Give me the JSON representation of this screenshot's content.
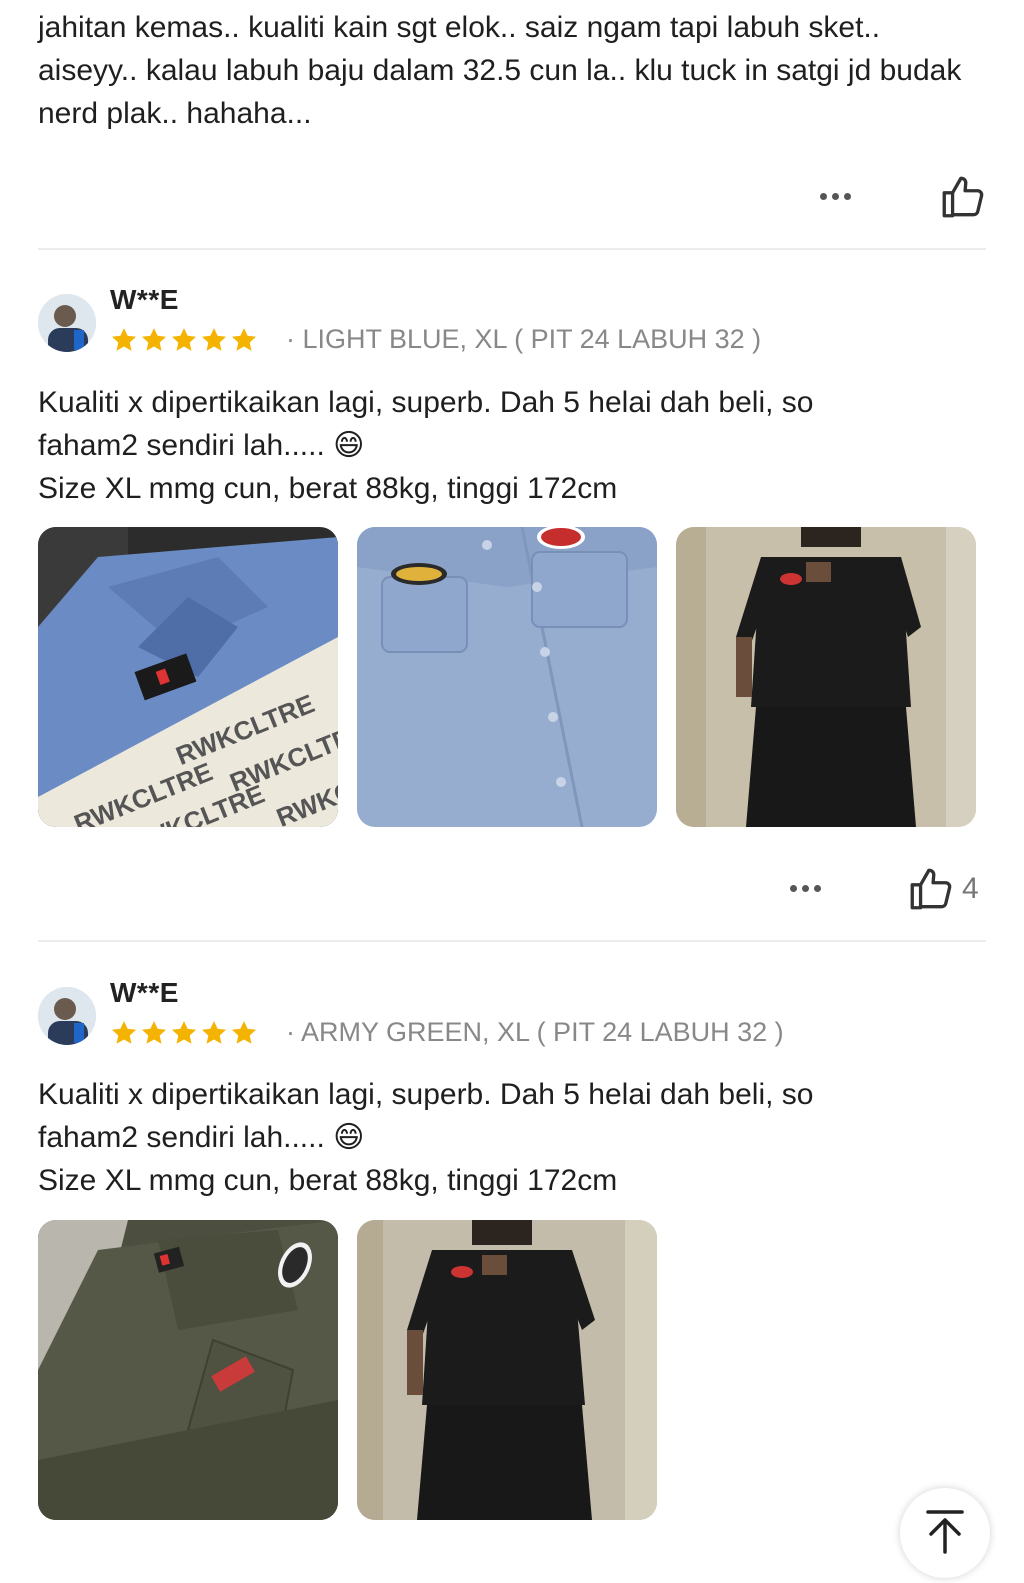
{
  "top_review": {
    "text": "jahitan kemas.. kualiti kain sgt elok.. saiz ngam tapi labuh sket.. aiseyy.. kalau labuh baju dalam 32.5 cun la.. klu tuck in satgi jd budak nerd plak.. hahaha..."
  },
  "reviews": [
    {
      "reviewer": "W**E",
      "rating": 5,
      "variant": "· LIGHT BLUE, XL ( PIT 24 LABUH 32 )",
      "text_line1": "Kualiti x dipertikaikan lagi, superb. Dah 5 helai dah beli, so",
      "text_line2": "faham2 sendiri lah..... 😄",
      "text_line3": "Size XL mmg cun, berat 88kg, tinggi 172cm",
      "photo_labels": [
        "RWKCLTRE",
        "RWKCLTRE",
        "RWKCLTRE",
        "RWKCLTRE",
        "RWKCLTRE"
      ],
      "like_count": "4"
    },
    {
      "reviewer": "W**E",
      "rating": 5,
      "variant": "· ARMY GREEN, XL ( PIT 24 LABUH 32 )",
      "text_line1": "Kualiti x dipertikaikan lagi, superb. Dah 5 helai dah beli, so",
      "text_line2": "faham2 sendiri lah..... 😄",
      "text_line3": "Size XL mmg cun, berat 88kg, tinggi 172cm"
    }
  ],
  "colors": {
    "star": "#f5b301",
    "divider": "#ececec",
    "text": "#1f1f1f",
    "muted": "#888888"
  },
  "icons": {
    "more": "more-dots-icon",
    "like": "thumbs-up-icon",
    "star": "star-icon",
    "back_to_top": "arrow-up-icon"
  }
}
